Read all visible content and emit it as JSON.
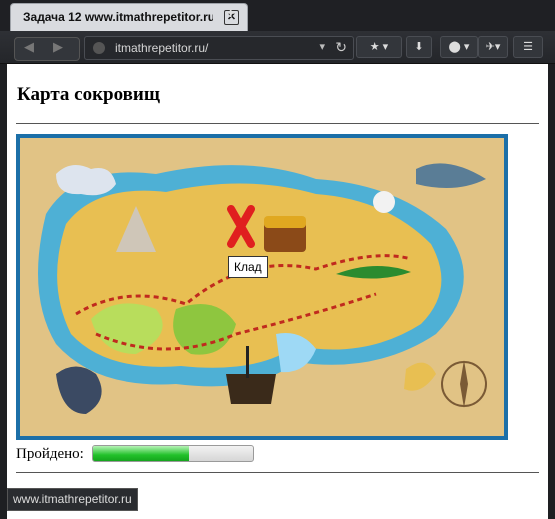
{
  "browser": {
    "tab_title": "Задача 12 www.itmathrepetitor.ru",
    "tab_close": "✕",
    "new_tab": "+",
    "url": "itmathrepetitor.ru/",
    "status_url": "www.itmathrepetitor.ru"
  },
  "page": {
    "title": "Карта сокровищ",
    "tooltip": "Клад",
    "progress_label": "Пройдено:",
    "progress_fraction": 0.6
  },
  "colors": {
    "sea": "#1c6fa8",
    "sand": "#e9c36a",
    "path": "#c02a1e",
    "progress": "#22c12a"
  }
}
